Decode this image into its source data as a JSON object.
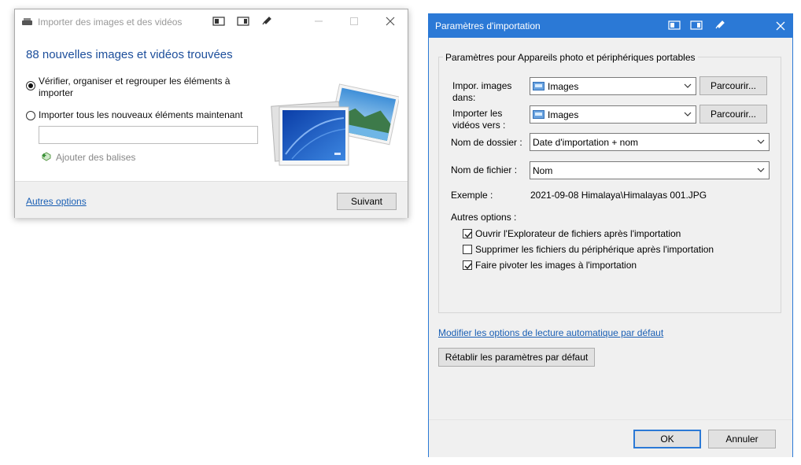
{
  "import_window": {
    "title": "Importer des images et des vidéos",
    "heading": "88 nouvelles images et vidéos trouvées",
    "option_review": {
      "line1": "Vérifier, organiser et regrouper les éléments à",
      "line2": "importer",
      "selected": true
    },
    "option_import_all": {
      "label": "Importer tous les nouveaux éléments maintenant",
      "selected": false
    },
    "tags_input": {
      "value": "",
      "placeholder": ""
    },
    "add_tags_label": "Ajouter des balises",
    "more_options_link": "Autres options",
    "next_button": "Suivant"
  },
  "settings_window": {
    "title": "Paramètres d'importation",
    "group_caption": "Paramètres pour  Appareils photo et périphériques portables",
    "images_row": {
      "label_line1": "Impor. images",
      "label_line2": "dans:",
      "value": "Images",
      "browse": "Parcourir..."
    },
    "videos_row": {
      "label_line1": "Importer les",
      "label_line2": "vidéos vers :",
      "value": "Images",
      "browse": "Parcourir..."
    },
    "folder_name": {
      "label": "Nom de dossier :",
      "value": "Date d'importation + nom"
    },
    "file_name": {
      "label": "Nom de fichier :",
      "value": "Nom"
    },
    "example": {
      "label": "Exemple :",
      "value": "2021-09-08 Himalaya\\Himalayas 001.JPG"
    },
    "other_options_label": "Autres options :",
    "checkboxes": [
      {
        "label": "Ouvrir l'Explorateur de fichiers après l'importation",
        "checked": true
      },
      {
        "label": "Supprimer les fichiers du périphérique après l'importation",
        "checked": false
      },
      {
        "label": "Faire pivoter les images à l'importation",
        "checked": true
      }
    ],
    "autoplay_link": "Modifier les options de lecture automatique par défaut",
    "reset_button": "Rétablir les paramètres par défaut",
    "ok_button": "OK",
    "cancel_button": "Annuler"
  },
  "colors": {
    "accent": "#2b79d6",
    "heading": "#1c4e9b",
    "link": "#1a5fb4"
  }
}
